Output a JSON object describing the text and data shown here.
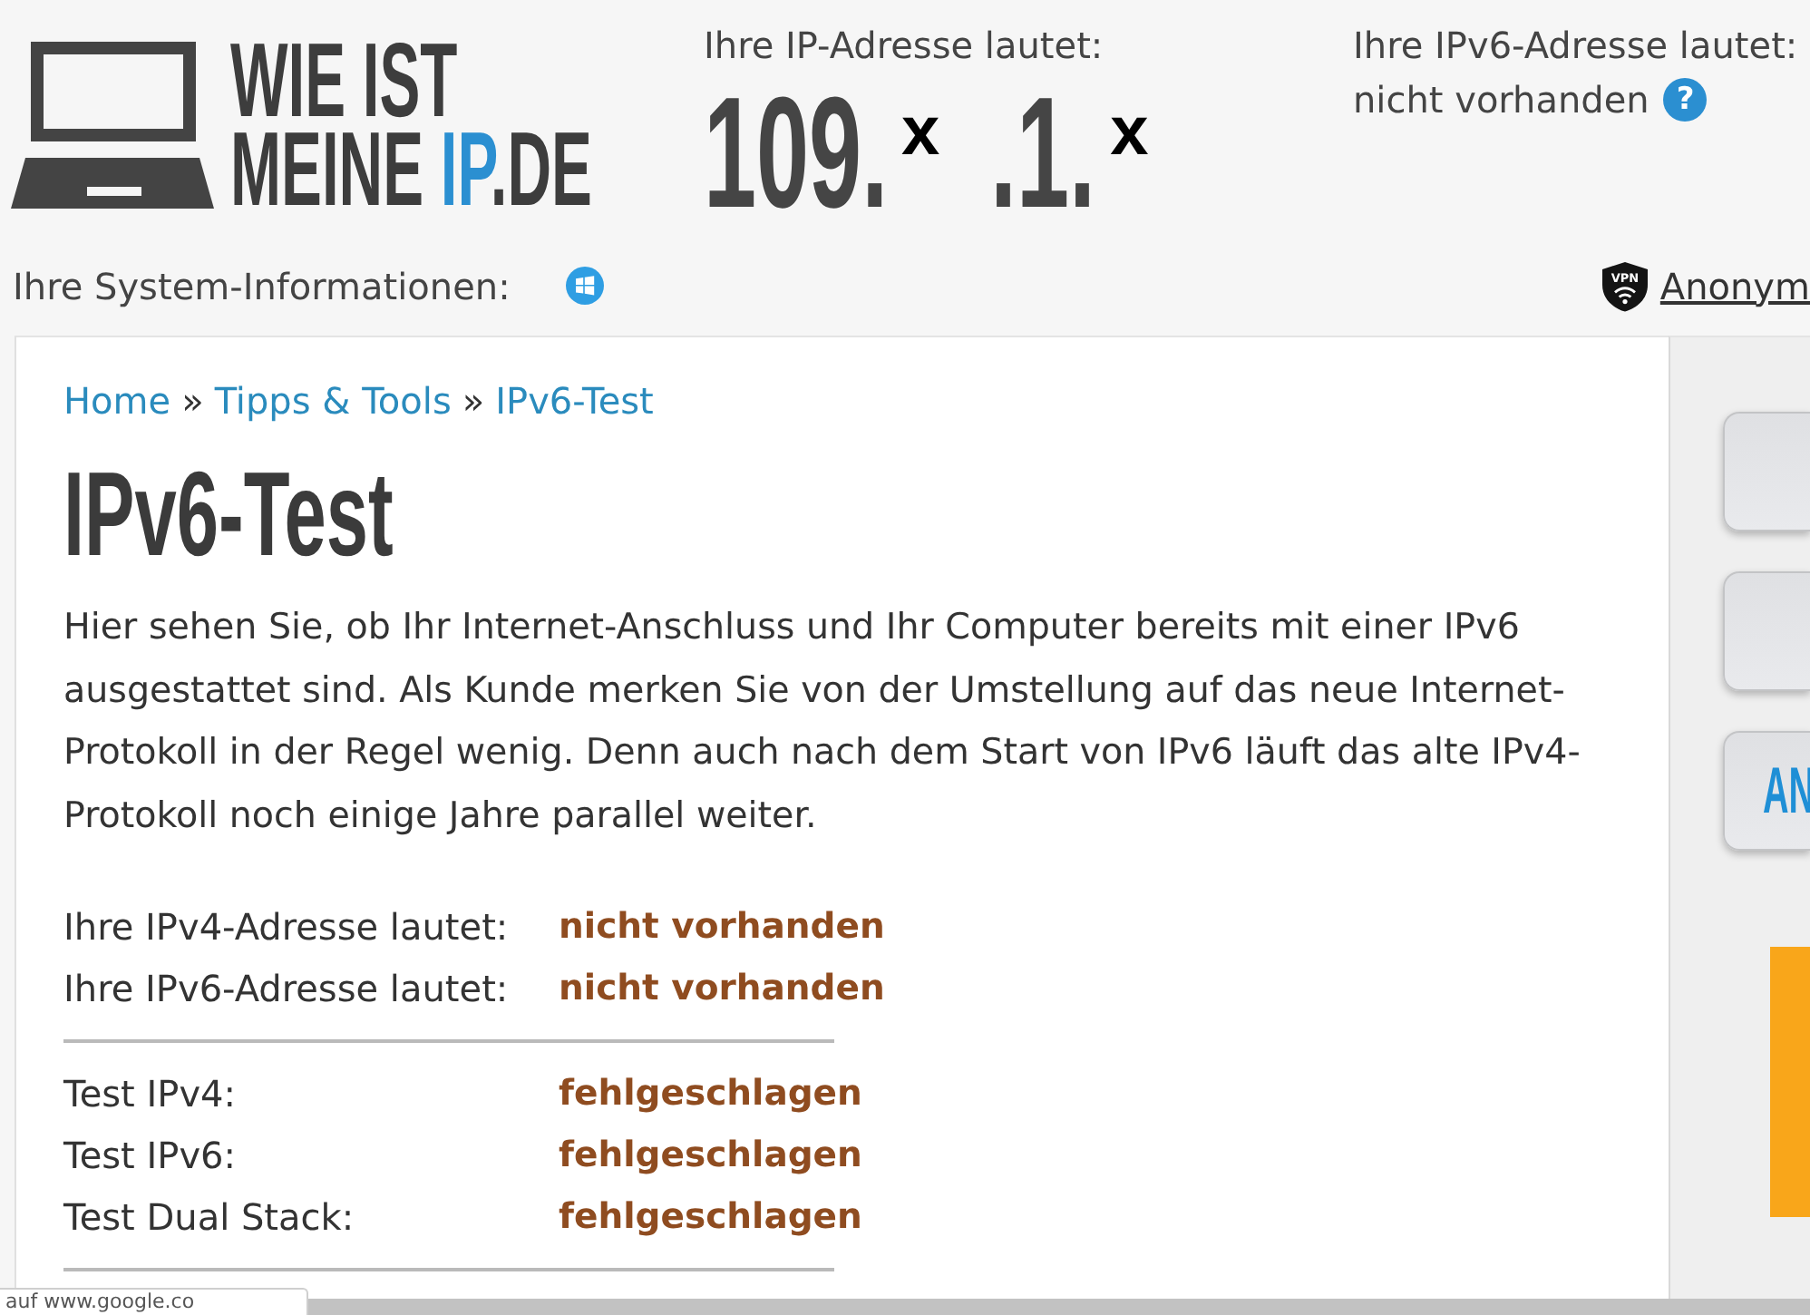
{
  "header": {
    "logo": {
      "lines": [
        [
          {
            "text": "WIE IST",
            "accent": false
          }
        ],
        [
          {
            "text": "MEINE ",
            "accent": false
          },
          {
            "text": "IP",
            "accent": true
          },
          {
            "text": ".DE",
            "accent": false
          }
        ]
      ]
    },
    "ip_address": {
      "label": "Ihre IP-Adresse lautet:",
      "segments": [
        {
          "kind": "digits",
          "text": "109."
        },
        {
          "kind": "mark",
          "text": "x"
        },
        {
          "kind": "digits",
          "text": ".1."
        },
        {
          "kind": "mark",
          "text": "x"
        }
      ]
    },
    "ipv6_address": {
      "label": "Ihre IPv6-Adresse lautet:",
      "value": "nicht vorhanden",
      "help": "?"
    },
    "system_info": {
      "label": "Ihre System-Informationen:"
    },
    "anonymity": {
      "badge": "VPN",
      "link": "Anonym"
    }
  },
  "breadcrumb": [
    {
      "kind": "link",
      "text": "Home"
    },
    {
      "kind": "separator",
      "text": "»"
    },
    {
      "kind": "link",
      "text": "Tipps & Tools"
    },
    {
      "kind": "separator",
      "text": "»"
    },
    {
      "kind": "link",
      "text": "IPv6-Test"
    }
  ],
  "title": "IPv6-Test",
  "intro": "Hier sehen Sie, ob Ihr Internet-Anschluss und Ihr Computer bereits mit einer IPv6 ausgestattet sind. Als Kunde merken Sie von der Umstellung auf das neue Internet-Protokoll in der Regel wenig. Denn auch nach dem Start von IPv6 läuft das alte IPv4-Protokoll noch einige Jahre parallel weiter.",
  "result_groups": [
    [
      {
        "label": "Ihre IPv4-Adresse lautet:",
        "value": "nicht vorhanden"
      },
      {
        "label": "Ihre IPv6-Adresse lautet:",
        "value": "nicht vorhanden"
      }
    ],
    [
      {
        "label": "Test IPv4:",
        "value": "fehlgeschlagen"
      },
      {
        "label": "Test IPv6:",
        "value": "fehlgeschlagen"
      },
      {
        "label": "Test Dual Stack:",
        "value": "fehlgeschlagen"
      }
    ]
  ],
  "sidebar": {
    "buttons": [
      {
        "kind": "blank"
      },
      {
        "kind": "blank"
      },
      {
        "kind": "labeled",
        "label": "AN"
      }
    ]
  },
  "status_bar": {
    "text": "auf www.google.co"
  }
}
